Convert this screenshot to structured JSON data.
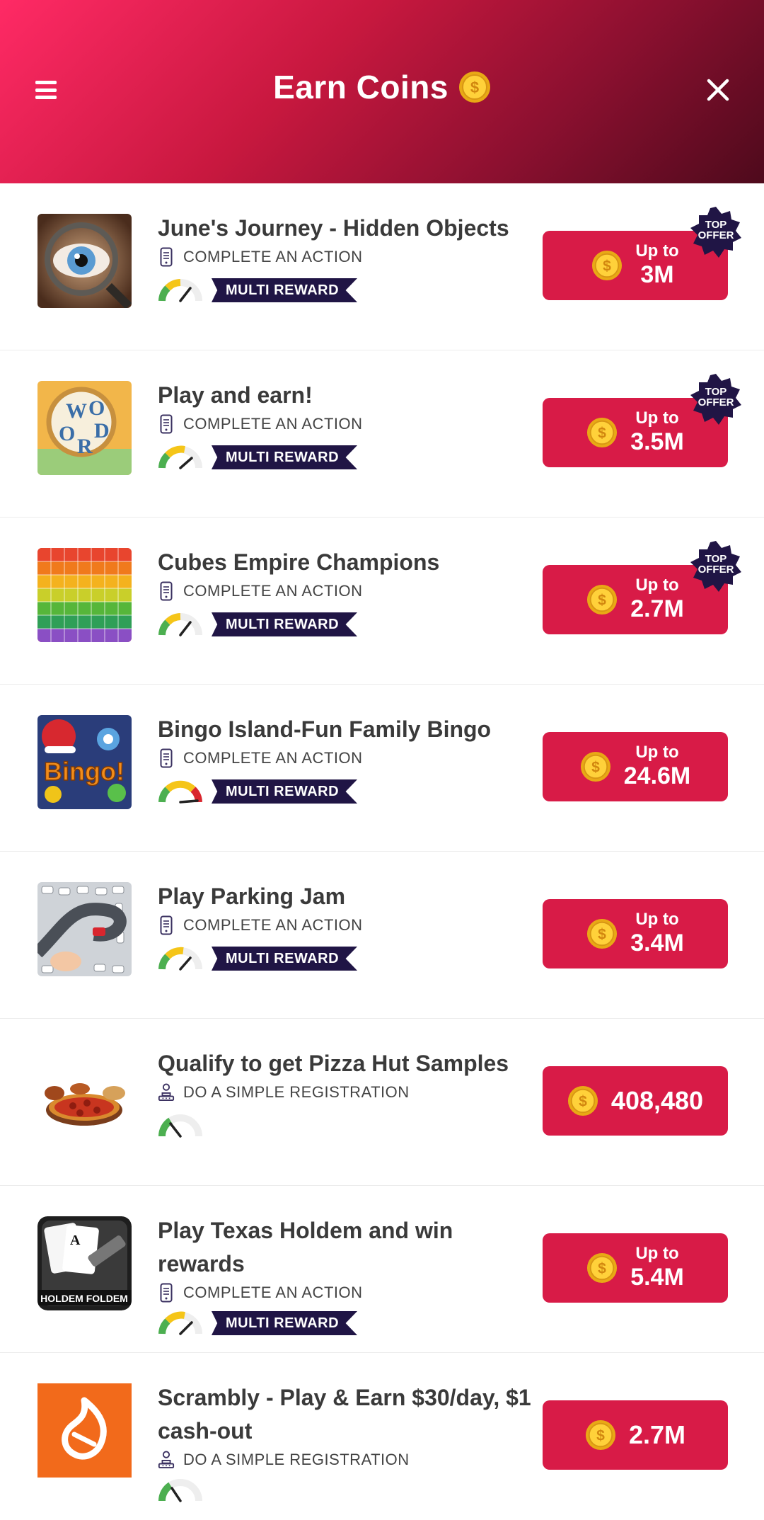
{
  "header": {
    "title": "Earn Coins",
    "gradient_start": "#ff2a65",
    "gradient_end": "#4e0a1c"
  },
  "badge_text_line1": "TOP",
  "badge_text_line2": "OFFER",
  "offers": [
    {
      "name": "June's Journey - Hidden Objects",
      "action": "COMPLETE AN ACTION",
      "action_icon": "phone-icon",
      "tag": "MULTI REWARD",
      "upto": "Up to",
      "amount": "3M",
      "top_offer": true
    },
    {
      "name": "Play and earn!",
      "action": "COMPLETE AN ACTION",
      "action_icon": "phone-icon",
      "tag": "MULTI REWARD",
      "upto": "Up to",
      "amount": "3.5M",
      "top_offer": true
    },
    {
      "name": "Cubes Empire Champions",
      "action": "COMPLETE AN ACTION",
      "action_icon": "phone-icon",
      "tag": "MULTI REWARD",
      "upto": "Up to",
      "amount": "2.7M",
      "top_offer": true
    },
    {
      "name": "Bingo Island-Fun Family Bingo",
      "action": "COMPLETE AN ACTION",
      "action_icon": "phone-icon",
      "tag": "MULTI REWARD",
      "upto": "Up to",
      "amount": "24.6M",
      "top_offer": false
    },
    {
      "name": "Play Parking Jam",
      "action": "COMPLETE AN ACTION",
      "action_icon": "phone-icon",
      "tag": "MULTI REWARD",
      "upto": "Up to",
      "amount": "3.4M",
      "top_offer": false
    },
    {
      "name": "Qualify to get Pizza Hut Samples",
      "action": "DO A SIMPLE REGISTRATION",
      "action_icon": "registration-icon",
      "tag": "",
      "upto": "",
      "amount": "408,480",
      "top_offer": false
    },
    {
      "name": "Play Texas Holdem and win rewards",
      "action": "COMPLETE AN ACTION",
      "action_icon": "phone-icon",
      "tag": "MULTI REWARD",
      "upto": "Up to",
      "amount": "5.4M",
      "top_offer": false
    },
    {
      "name": "Scrambly - Play & Earn $30/day, $1 cash-out",
      "action": "DO A SIMPLE REGISTRATION",
      "action_icon": "registration-icon",
      "tag": "",
      "upto": "",
      "amount": "2.7M",
      "top_offer": false
    }
  ],
  "thumb_texts": {
    "bingo": "Bingo!",
    "holdem": "HOLDEM FOLDEM"
  }
}
